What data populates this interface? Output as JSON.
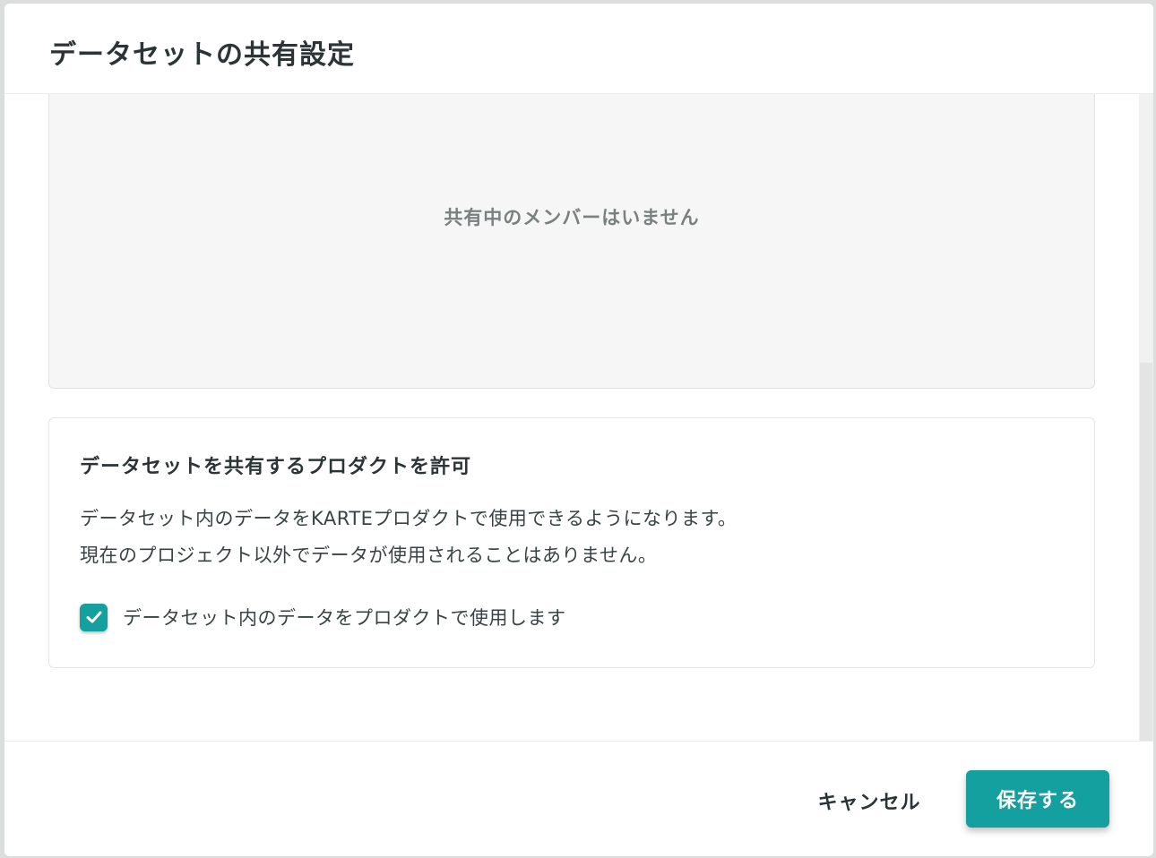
{
  "dialog": {
    "title": "データセットの共有設定"
  },
  "members": {
    "empty_text": "共有中のメンバーはいません"
  },
  "permission": {
    "title": "データセットを共有するプロダクトを許可",
    "description_lines": [
      "データセット内のデータをKARTEプロダクトで使用できるようになります。",
      "現在のプロジェクト以外でデータが使用されることはありません。"
    ],
    "checkbox": {
      "label": "データセット内のデータをプロダクトで使用します",
      "checked": true
    }
  },
  "footer": {
    "cancel_label": "キャンセル",
    "save_label": "保存する"
  },
  "colors": {
    "accent": "#15a0a0",
    "text_primary": "#2c3436",
    "text_muted": "#7a7f80",
    "empty_bg": "#f6f6f6"
  },
  "icons": {
    "checkbox": "checkmark-icon"
  }
}
